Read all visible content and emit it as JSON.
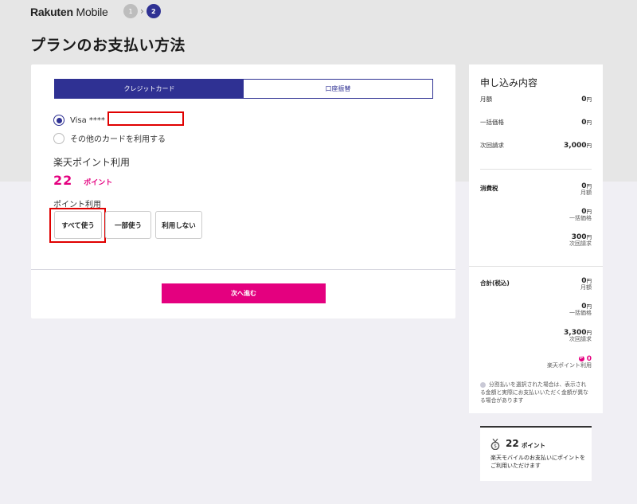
{
  "header": {
    "logo_bold": "Rakuten",
    "logo_rest": " Mobile",
    "steps": [
      "1",
      "2"
    ],
    "step_sep": "›"
  },
  "page_title": "プランのお支払い方法",
  "payment": {
    "tabs": [
      {
        "label": "クレジットカード",
        "active": true
      },
      {
        "label": "口座振替",
        "active": false
      }
    ],
    "options": [
      {
        "label": "Visa ****",
        "checked": true
      },
      {
        "label": "その他のカードを利用する",
        "checked": false
      }
    ]
  },
  "points": {
    "heading": "楽天ポイント利用",
    "amount": "22",
    "unit": "ポイント",
    "use_label": "ポイント利用",
    "buttons": [
      "すべて使う",
      "一部使う",
      "利用しない"
    ]
  },
  "next_button": "次へ進む",
  "summary": {
    "title": "申し込み内容",
    "rows": [
      {
        "label": "月額",
        "amount": "0",
        "unit": "円"
      },
      {
        "label": "一括価格",
        "amount": "0",
        "unit": "円"
      },
      {
        "label": "次回請求",
        "amount": "3,000",
        "unit": "円"
      }
    ],
    "tax": {
      "label": "消費税",
      "items": [
        {
          "amount": "0",
          "unit": "円",
          "sub": "月額"
        },
        {
          "amount": "0",
          "unit": "円",
          "sub": "一括価格"
        },
        {
          "amount": "300",
          "unit": "円",
          "sub": "次回請求"
        }
      ]
    },
    "total": {
      "label": "合計(税込)",
      "items": [
        {
          "amount": "0",
          "unit": "円",
          "sub": "月額"
        },
        {
          "amount": "0",
          "unit": "円",
          "sub": "一括価格"
        },
        {
          "amount": "3,300",
          "unit": "円",
          "sub": "次回請求"
        }
      ],
      "points_amount": "0",
      "points_icon": "P",
      "points_sub": "楽天ポイント利用"
    },
    "note": "分割払いを選択された場合は、表示される金額と実際にお支払いいただく金額が異なる場合があります"
  },
  "promo": {
    "amount": "22",
    "unit": "ポイント",
    "text": "楽天モバイルのお支払いにポイントをご利用いただけます"
  },
  "colors": {
    "brand_navy": "#2f3193",
    "accent_pink": "#e4007f",
    "highlight_red": "#e00000"
  }
}
